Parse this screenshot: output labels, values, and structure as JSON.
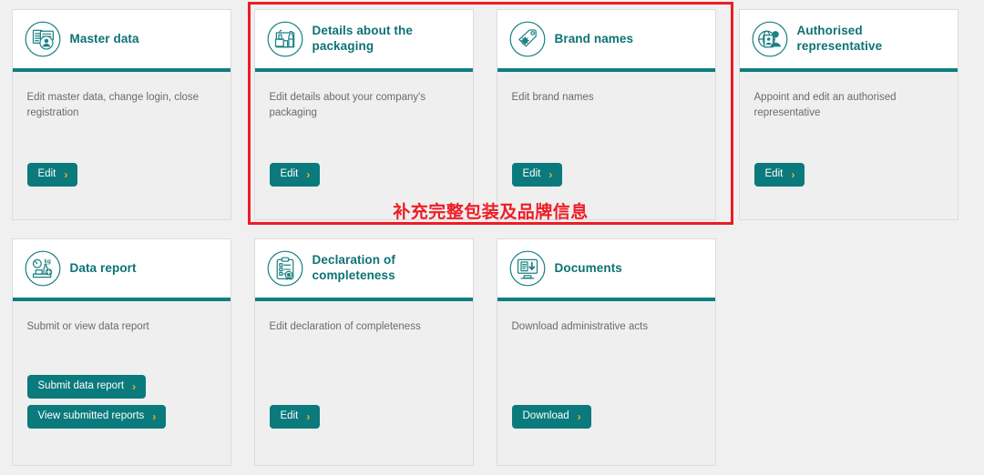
{
  "theme": {
    "accent_teal": "#0d7e80",
    "button_teal": "#0b7a7c",
    "chevron_yellow": "#f0b323",
    "annotation_red": "#ee1c25",
    "card_body_gray": "#efefef",
    "page_background": "#f0f0f0"
  },
  "annotation": {
    "text": "补充完整包装及品牌信息"
  },
  "chevron": "›",
  "rows": [
    {
      "cards": [
        {
          "id": "master-data",
          "icon": "master-data-icon",
          "title": "Master data",
          "description": "Edit master data, change login, close registration",
          "buttons": [
            {
              "id": "edit",
              "label": "Edit"
            }
          ]
        },
        {
          "id": "packaging-details",
          "icon": "packaging-icon",
          "title": "Details about the packaging",
          "description": "Edit details about your company's packaging",
          "buttons": [
            {
              "id": "edit",
              "label": "Edit"
            }
          ]
        },
        {
          "id": "brand-names",
          "icon": "brand-tag-icon",
          "title": "Brand names",
          "description": "Edit brand names",
          "buttons": [
            {
              "id": "edit",
              "label": "Edit"
            }
          ]
        },
        {
          "id": "authorised-representative",
          "icon": "authorised-representative-icon",
          "title": "Authorised representative",
          "description": "Appoint and edit an authorised representative",
          "buttons": [
            {
              "id": "edit",
              "label": "Edit"
            }
          ]
        }
      ]
    },
    {
      "cards": [
        {
          "id": "data-report",
          "icon": "data-report-scale-icon",
          "title": "Data report",
          "description": "Submit or view data report",
          "buttons": [
            {
              "id": "submit-data-report",
              "label": "Submit data report"
            },
            {
              "id": "view-submitted-reports",
              "label": "View submitted reports"
            }
          ]
        },
        {
          "id": "declaration-of-completeness",
          "icon": "clipboard-seal-icon",
          "title": "Declaration of completeness",
          "description": "Edit declaration of completeness",
          "buttons": [
            {
              "id": "edit",
              "label": "Edit"
            }
          ]
        },
        {
          "id": "documents",
          "icon": "document-download-icon",
          "title": "Documents",
          "description": "Download administrative acts",
          "buttons": [
            {
              "id": "download",
              "label": "Download"
            }
          ]
        }
      ]
    }
  ]
}
